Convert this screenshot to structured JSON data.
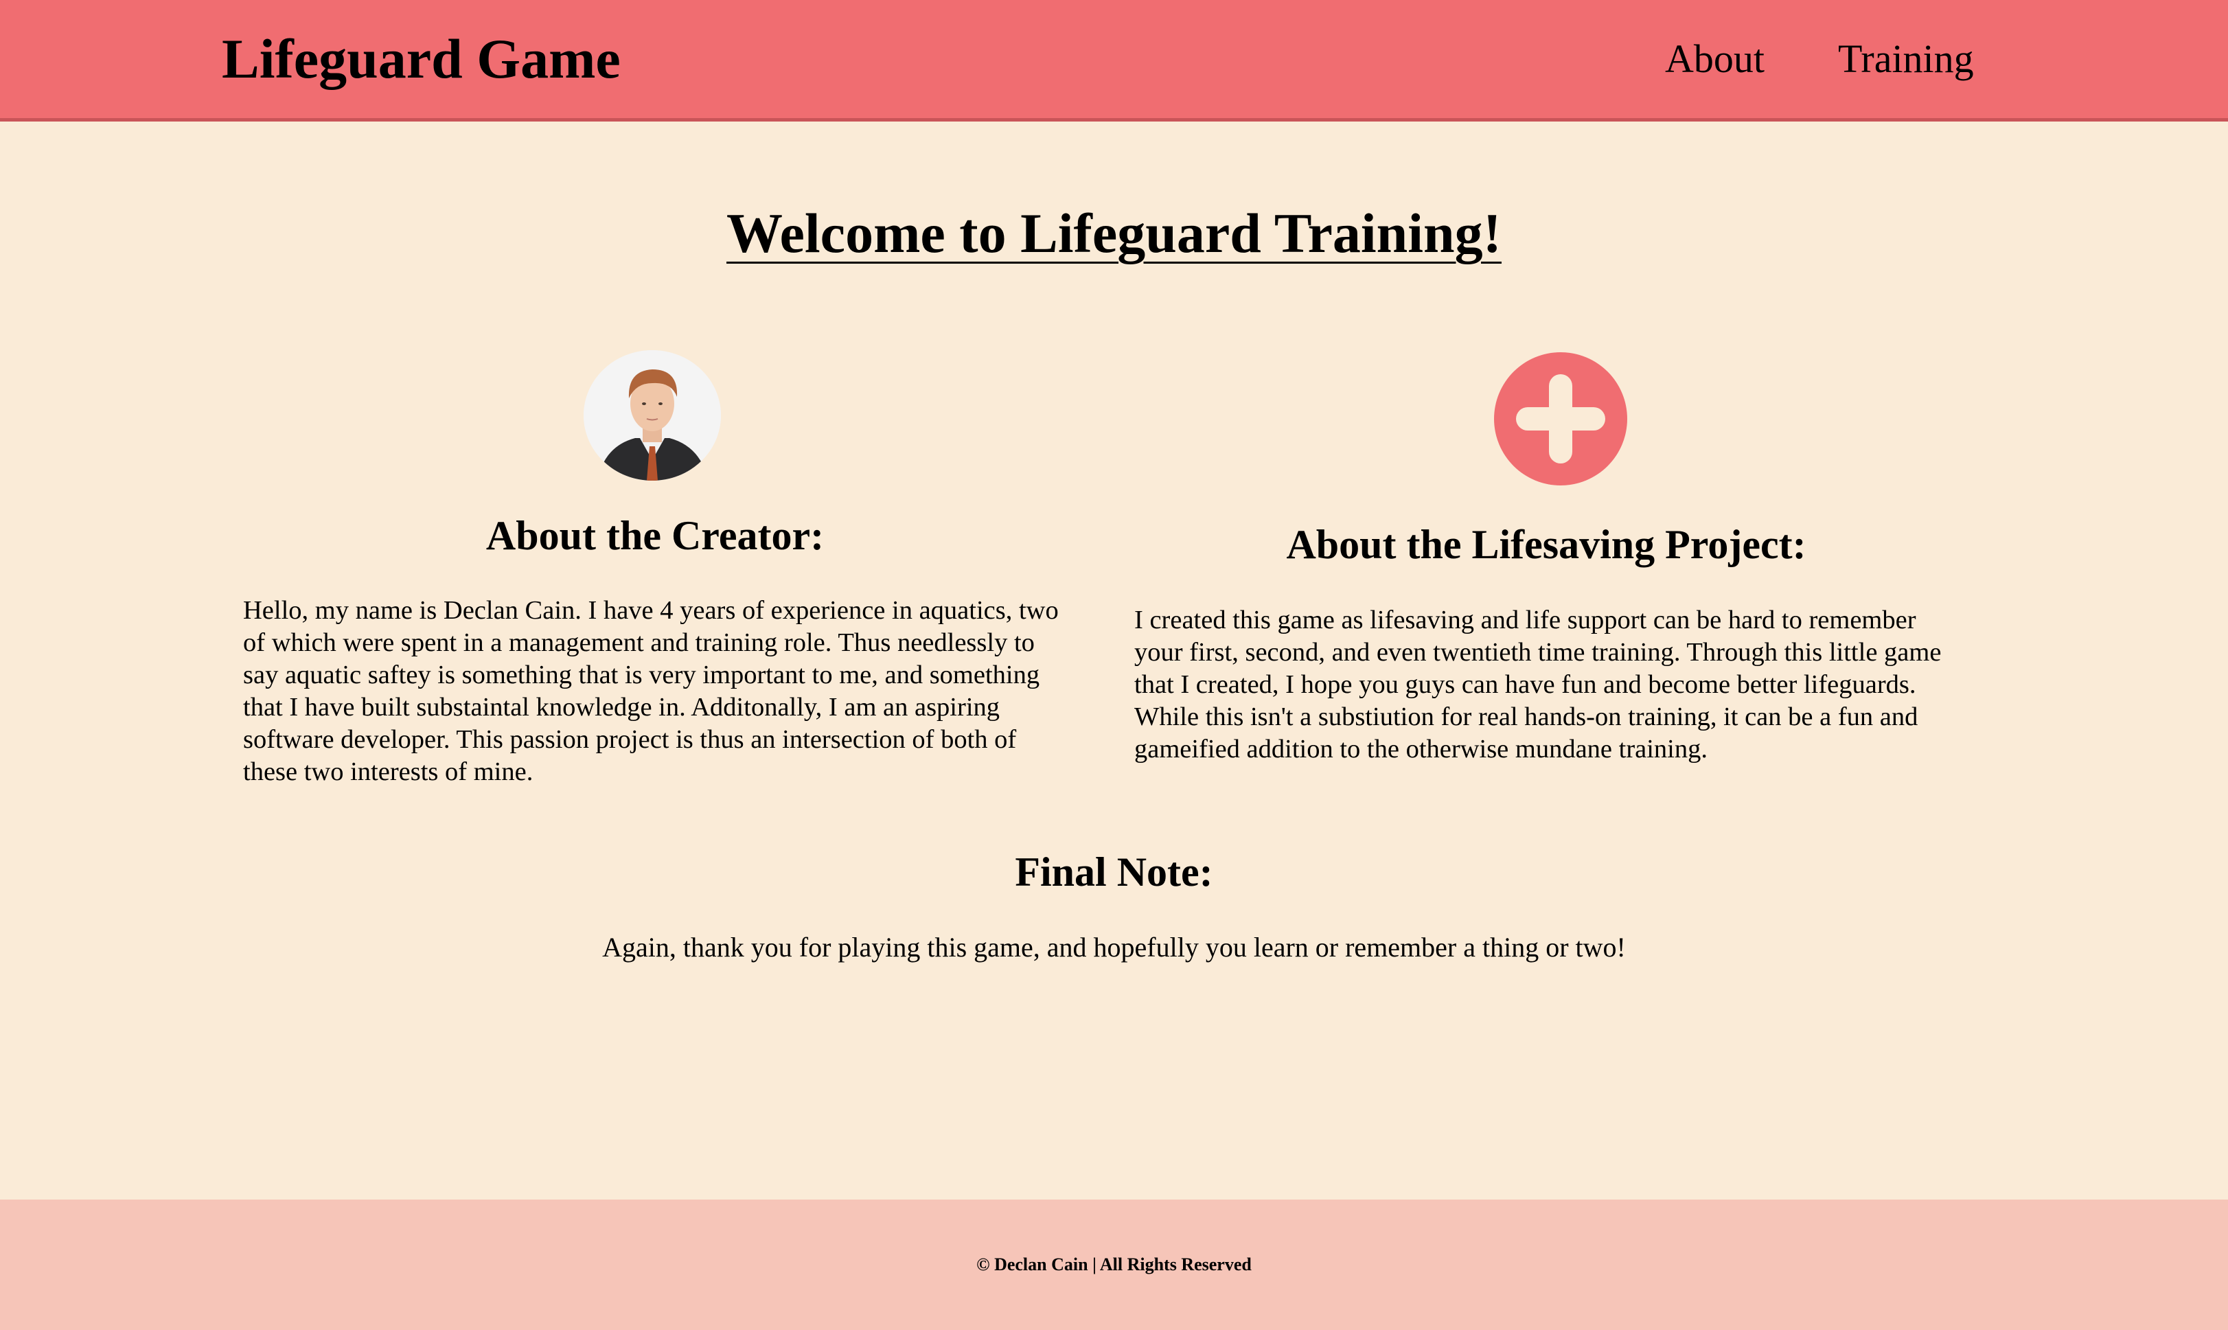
{
  "header": {
    "brand": "Lifeguard Game",
    "nav": [
      {
        "label": "About"
      },
      {
        "label": "Training"
      }
    ]
  },
  "main": {
    "welcome_title": "Welcome to Lifeguard Training!",
    "creator": {
      "heading": "About the Creator:",
      "text": "Hello, my name is Declan Cain. I have 4 years of experience in aquatics, two of which were spent in a management and training role. Thus needlessly to say aquatic saftey is something that is very important to me, and something that I have built substaintal knowledge in. Additonally, I am an aspiring software developer. This passion project is thus an intersection of both of these two interests of mine."
    },
    "project": {
      "heading": "About the Lifesaving Project:",
      "text": "I created this game as lifesaving and life support can be hard to remember your first, second, and even twentieth time training. Through this little game that I created, I hope you guys can have fun and become better lifeguards. While this isn't a substiution for real hands-on training, it can be a fun and gameified addition to the otherwise mundane training."
    },
    "final": {
      "heading": "Final Note:",
      "text": "Again, thank you for playing this game, and hopefully you learn or remember a thing or two!"
    }
  },
  "footer": {
    "text": "© Declan Cain | All Rights Reserved"
  },
  "colors": {
    "header_bg": "#f06d71",
    "page_bg": "#faebd7",
    "footer_bg": "#f6c5b8",
    "accent": "#f06d71"
  },
  "icons": {
    "logo": "plus-cross-icon",
    "avatar": "creator-portrait"
  }
}
